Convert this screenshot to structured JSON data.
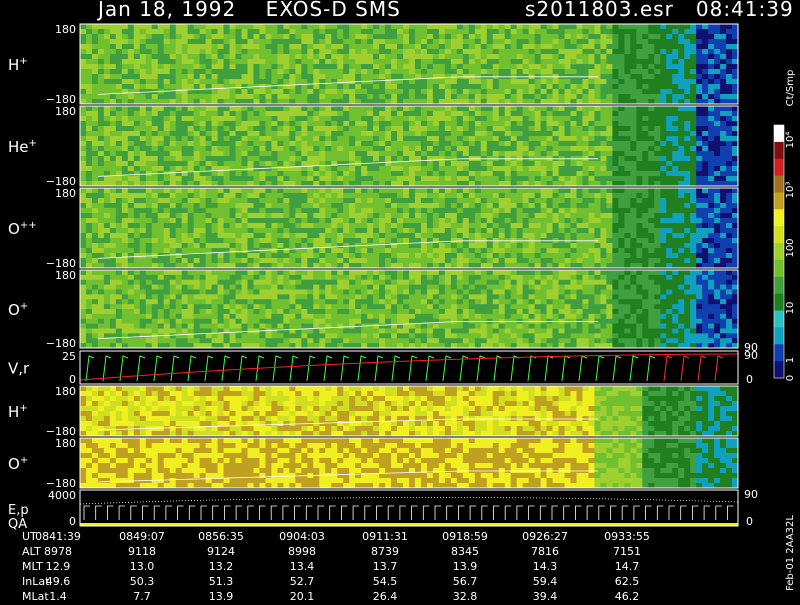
{
  "header": {
    "title": "Jan 18, 1992    EXOS-D SMS",
    "file_time": "s2011803.esr   08:41:39"
  },
  "colors": {
    "scale": [
      "#101070",
      "#1040b0",
      "#10a0c0",
      "#30c0c0",
      "#208020",
      "#40a040",
      "#70c030",
      "#a0d030",
      "#d0e020",
      "#f0f020",
      "#c0a020",
      "#a07020",
      "#d02020",
      "#801010",
      "#ffffff"
    ]
  },
  "chart_data": {
    "type": "heatmap",
    "panels": [
      {
        "label": "H",
        "sup": "+",
        "ytop": "180",
        "ybot": "−180",
        "mode": "angle"
      },
      {
        "label": "He",
        "sup": "+",
        "ytop": "180",
        "ybot": "−180",
        "mode": "angle"
      },
      {
        "label": "O",
        "sup": "++",
        "ytop": "180",
        "ybot": "−180",
        "mode": "angle"
      },
      {
        "label": "O",
        "sup": "+",
        "ytop": "180",
        "ybot": "−180",
        "mode": "angle",
        "right_tick": "90"
      },
      {
        "label": "V,r",
        "sup": "",
        "ytop": "25",
        "ybot": "0",
        "mode": "vr",
        "right_top": "90",
        "right_bot": "0"
      },
      {
        "label": "H",
        "sup": "+",
        "ytop": "180",
        "ybot": "−180",
        "mode": "yellow"
      },
      {
        "label": "O",
        "sup": "+",
        "ytop": "180",
        "ybot": "−180",
        "mode": "yellowO"
      },
      {
        "label": "E,p",
        "label2": "QA",
        "sup": "",
        "ytop": "4000",
        "ybot": "0",
        "mode": "ep",
        "right_top": "90",
        "right_bot": "0"
      }
    ],
    "colorbar": {
      "unit": "Ct/Smp",
      "ticks": [
        "10⁴",
        "10³",
        "100",
        "10",
        "1",
        "0"
      ]
    },
    "side_label": "Feb-01 2AA32L",
    "footer": {
      "rows": [
        {
          "label": "UT",
          "values": [
            "0841:39",
            "0849:07",
            "0856:35",
            "0904:03",
            "0911:31",
            "0918:59",
            "0926:27",
            "0933:55"
          ]
        },
        {
          "label": "ALT",
          "values": [
            "8978",
            "9118",
            "9124",
            "8998",
            "8739",
            "8345",
            "7816",
            "7151"
          ]
        },
        {
          "label": "MLT",
          "values": [
            "12.9",
            "13.0",
            "13.2",
            "13.4",
            "13.7",
            "13.9",
            "14.3",
            "14.7"
          ]
        },
        {
          "label": "InLat",
          "values": [
            "49.6",
            "50.3",
            "51.3",
            "52.7",
            "54.5",
            "56.7",
            "59.4",
            "62.5"
          ]
        },
        {
          "label": "MLat",
          "values": [
            "1.4",
            "7.7",
            "13.9",
            "20.1",
            "26.4",
            "32.8",
            "39.4",
            "46.2"
          ]
        }
      ]
    }
  }
}
